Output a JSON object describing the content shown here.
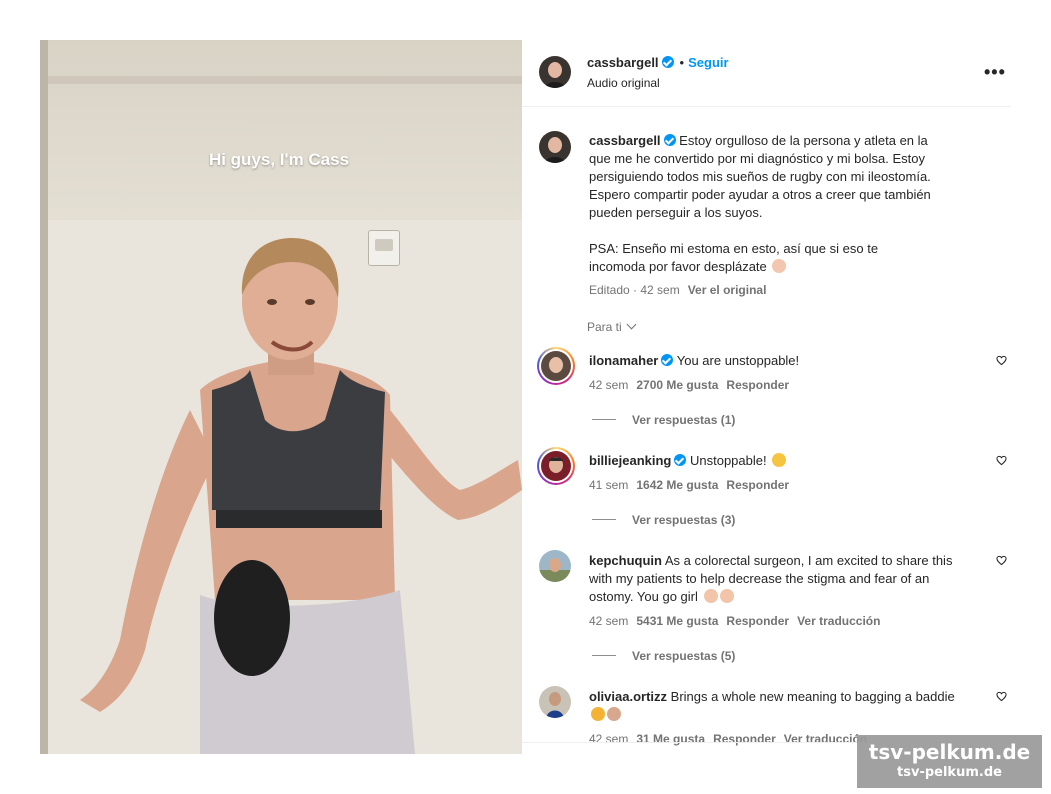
{
  "video": {
    "overlay_text": "Hi guys, I'm Cass"
  },
  "post_header": {
    "username": "cassbargell",
    "separator": "•",
    "follow_label": "Seguir",
    "audio_label": "Audio original",
    "more_icon": "more-horizontal-icon"
  },
  "caption": {
    "username": "cassbargell",
    "text": "Estoy orgulloso de la persona y atleta en la que me he convertido por mi diagnóstico y mi bolsa. Estoy persiguiendo todos mis sueños de rugby con mi ileostomía. Espero compartir poder ayudar a otros a creer que también pueden perseguir a los suyos.",
    "psa": "PSA: Enseño mi estoma en esto, así que si eso te incomoda por favor desplázate",
    "edited_time": "Editado · 42 sem",
    "see_original": "Ver el original"
  },
  "for_you_label": "Para ti",
  "comments": [
    {
      "username": "ilonamaher",
      "verified": true,
      "text": "You are unstoppable!",
      "time": "42 sem",
      "likes": "2700 Me gusta",
      "reply": "Responder",
      "translate": "",
      "replies": "Ver respuestas (1)"
    },
    {
      "username": "billiejeanking",
      "verified": true,
      "text": "Unstoppable!",
      "time": "41 sem",
      "likes": "1642 Me gusta",
      "reply": "Responder",
      "translate": "",
      "replies": "Ver respuestas (3)"
    },
    {
      "username": "kepchuquin",
      "verified": false,
      "text": "As a colorectal surgeon, I am excited to share this with my patients to help decrease the stigma and fear of an ostomy. You go girl",
      "time": "42 sem",
      "likes": "5431 Me gusta",
      "reply": "Responder",
      "translate": "Ver traducción",
      "replies": "Ver respuestas (5)"
    },
    {
      "username": "oliviaa.ortizz",
      "verified": false,
      "text": "Brings a whole new meaning to bagging a baddie",
      "time": "42 sem",
      "likes": "31 Me gusta",
      "reply": "Responder",
      "translate": "Ver traducción",
      "replies": ""
    }
  ],
  "watermark": {
    "line1": "tsv-pelkum.de",
    "line2": "tsv-pelkum.de"
  },
  "colors": {
    "link_blue": "#0095f6",
    "muted": "#737373",
    "text": "#262626"
  }
}
